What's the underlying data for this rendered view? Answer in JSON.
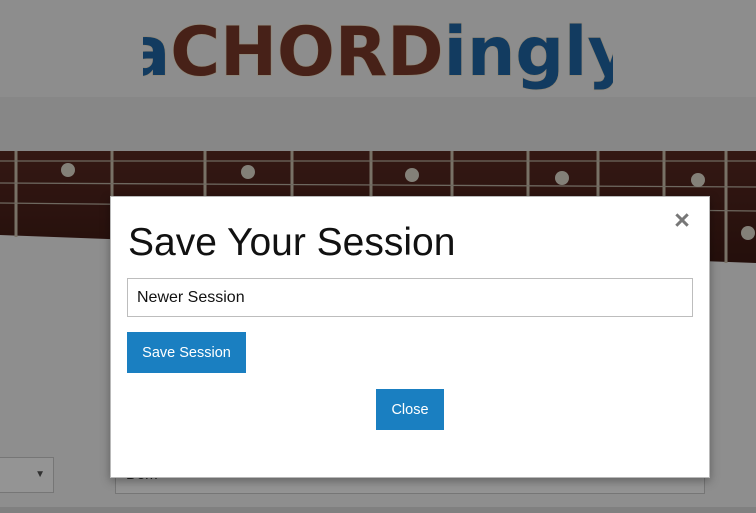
{
  "app": {
    "logo": {
      "prefix": "a",
      "emphasis": "CHORD",
      "suffix": "ingly"
    }
  },
  "colors": {
    "logo_blue": "#1f66a6",
    "logo_brown": "#7a3a2a",
    "button_blue": "#1a7fc1"
  },
  "background_form": {
    "select_arrow_icon": "triangle-down-icon",
    "input_value": "Dom"
  },
  "modal": {
    "title": "Save Your Session",
    "close_icon": "close-icon",
    "close_glyph": "×",
    "session_name_value": "Newer Session",
    "save_button_label": "Save Session",
    "close_button_label": "Close"
  }
}
